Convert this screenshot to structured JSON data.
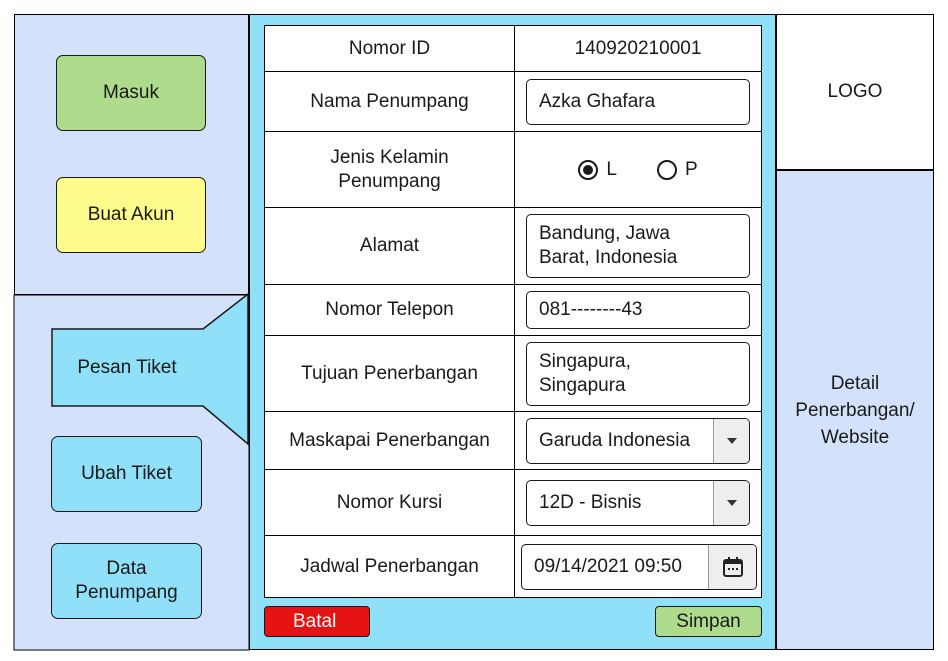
{
  "sidebar": {
    "login_label": "Masuk",
    "register_label": "Buat Akun",
    "book_ticket_label": "Pesan Tiket",
    "change_ticket_label": "Ubah Tiket",
    "passenger_data_label": "Data Penumpang"
  },
  "form": {
    "id_label": "Nomor ID",
    "id_value": "140920210001",
    "name_label": "Nama Penumpang",
    "name_value": "Azka Ghafara",
    "gender_label": "Jenis Kelamin Penumpang",
    "gender_options": [
      "L",
      "P"
    ],
    "gender_selected": "L",
    "address_label": "Alamat",
    "address_value": "Bandung, Jawa Barat, Indonesia",
    "phone_label": "Nomor Telepon",
    "phone_value": "081--------43",
    "destination_label": "Tujuan Penerbangan",
    "destination_value": "Singapura, Singapura",
    "airline_label": "Maskapai Penerbangan",
    "airline_value": "Garuda Indonesia",
    "seat_label": "Nomor Kursi",
    "seat_value": "12D - Bisnis",
    "schedule_label": "Jadwal Penerbangan",
    "schedule_value": "09/14/2021 09:50"
  },
  "actions": {
    "cancel_label": "Batal",
    "save_label": "Simpan"
  },
  "right": {
    "logo_label": "LOGO",
    "detail_label": "Detail Penerbangan/ Website"
  },
  "colors": {
    "sidebar_bg": "#d4e1fb",
    "center_bg": "#91e0fa",
    "login_btn": "#aedb8c",
    "register_btn": "#fdfb8b",
    "cancel_btn": "#e51313",
    "save_btn": "#aedb8c"
  },
  "icons": {
    "dropdown": "triangle-down-icon",
    "calendar": "calendar-icon"
  }
}
